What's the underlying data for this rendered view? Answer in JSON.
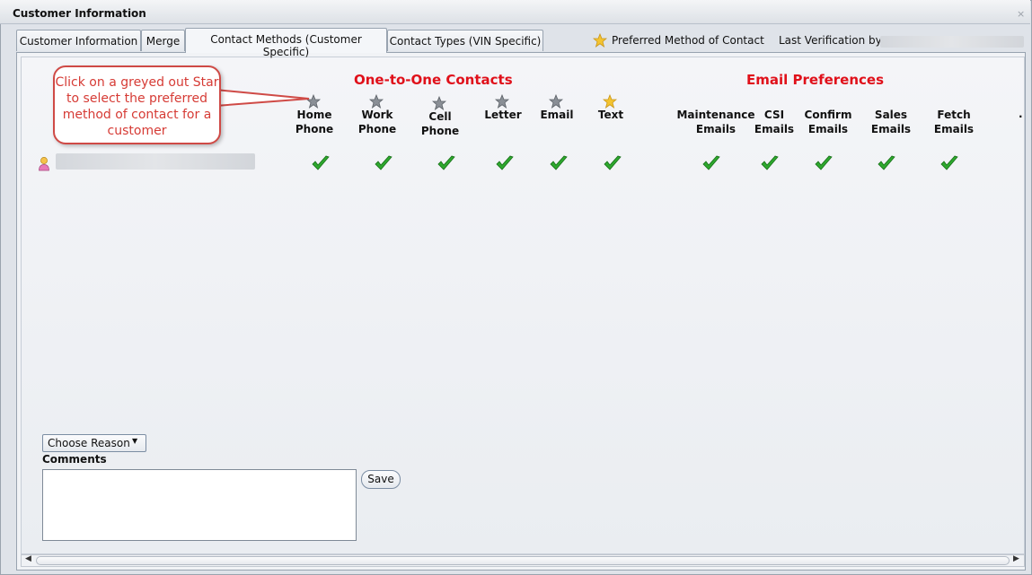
{
  "window": {
    "title": "Customer Information",
    "close_glyph": "×"
  },
  "tabs": [
    {
      "label": "Customer Information",
      "active": false
    },
    {
      "label": "Merge",
      "active": false
    },
    {
      "label": "Contact Methods (Customer Specific)",
      "active": true
    },
    {
      "label": "Contact Types (VIN Specific)",
      "active": false
    }
  ],
  "legend": {
    "preferred_label": "Preferred Method of Contact",
    "last_verification": "Last Verification by ."
  },
  "callout": {
    "text": "Click on a greyed out Star to select the preferred method of contact for a customer"
  },
  "sections": {
    "one_to_one": "One-to-One Contacts",
    "email_prefs": "Email Preferences"
  },
  "one_to_one_columns": [
    {
      "line1": "Home",
      "line2": "Phone",
      "star": "grey"
    },
    {
      "line1": "Work",
      "line2": "Phone",
      "star": "grey"
    },
    {
      "line1": "Cell",
      "line2": "Phone",
      "star": "grey"
    },
    {
      "line1": "Letter",
      "line2": "",
      "star": "grey"
    },
    {
      "line1": "Email",
      "line2": "",
      "star": "grey"
    },
    {
      "line1": "Text",
      "line2": "",
      "star": "gold"
    }
  ],
  "email_columns": [
    {
      "line1": "Maintenance",
      "line2": "Emails"
    },
    {
      "line1": "CSI",
      "line2": "Emails"
    },
    {
      "line1": "Confirm",
      "line2": "Emails"
    },
    {
      "line1": "Sales",
      "line2": "Emails"
    },
    {
      "line1": "Fetch",
      "line2": "Emails"
    }
  ],
  "overflow_marker": ".",
  "icons": {
    "customer": "person-icon",
    "check": "green-checkmark-icon",
    "star_grey": "grey-star-icon",
    "star_gold": "gold-star-icon"
  },
  "colors": {
    "section_heading": "#e0101a",
    "callout_border": "#cf4a46",
    "check_green": "#2ea82e",
    "star_gold": "#f4c430",
    "star_grey": "#8a8f96"
  },
  "form": {
    "reason_select": "Choose Reason",
    "comments_label": "Comments",
    "save_label": "Save"
  }
}
